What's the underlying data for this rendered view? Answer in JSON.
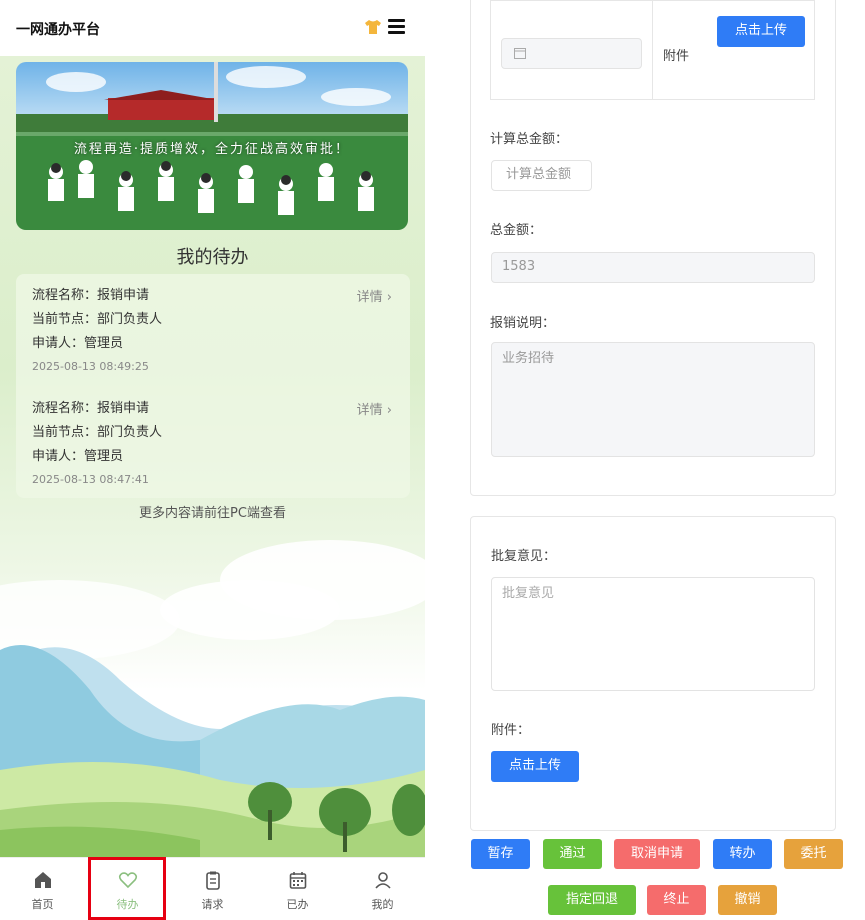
{
  "app": {
    "title": "一网通办平台"
  },
  "banner": {
    "caption": "流程再造·提质增效，全力征战高效审批！"
  },
  "todo": {
    "title": "我的待办",
    "detail_label": "详情",
    "items": [
      {
        "flow": "流程名称：报销申请",
        "node": "当前节点：部门负责人",
        "applicant": "申请人：管理员",
        "time": "2025-08-13 08:49:25"
      },
      {
        "flow": "流程名称：报销申请",
        "node": "当前节点：部门负责人",
        "applicant": "申请人：管理员",
        "time": "2025-08-13 08:47:41"
      }
    ],
    "more_text": "更多内容请前往PC端查看"
  },
  "tabbar": {
    "items": [
      {
        "label": "首页",
        "icon": "home-icon"
      },
      {
        "label": "待办",
        "icon": "heart-icon"
      },
      {
        "label": "请求",
        "icon": "clipboard-icon"
      },
      {
        "label": "已办",
        "icon": "calendar-icon"
      },
      {
        "label": "我的",
        "icon": "user-icon"
      }
    ],
    "active_index": 1
  },
  "form": {
    "attachment_cell_label": "附件",
    "upload_label": "点击上传",
    "calc_total_label": "计算总金额：",
    "calc_total_button": "计算总金额",
    "total_label": "总金额：",
    "total_value": "1583",
    "description_label": "报销说明：",
    "description_placeholder": "业务招待",
    "opinion_label": "批复意见：",
    "opinion_placeholder": "批复意见",
    "attachment_label": "附件："
  },
  "actions": {
    "save": "暂存",
    "approve": "通过",
    "cancel_request": "取消申请",
    "transfer": "转办",
    "delegate": "委托",
    "rollback": "指定回退",
    "terminate": "终止",
    "revoke": "撤销"
  },
  "colors": {
    "primary": "#2f7cf6",
    "success": "#67c23a",
    "danger": "#f56c6c",
    "warning": "#e6a23c",
    "active_tab": "#8bbf7f",
    "highlight": "#e60012"
  }
}
